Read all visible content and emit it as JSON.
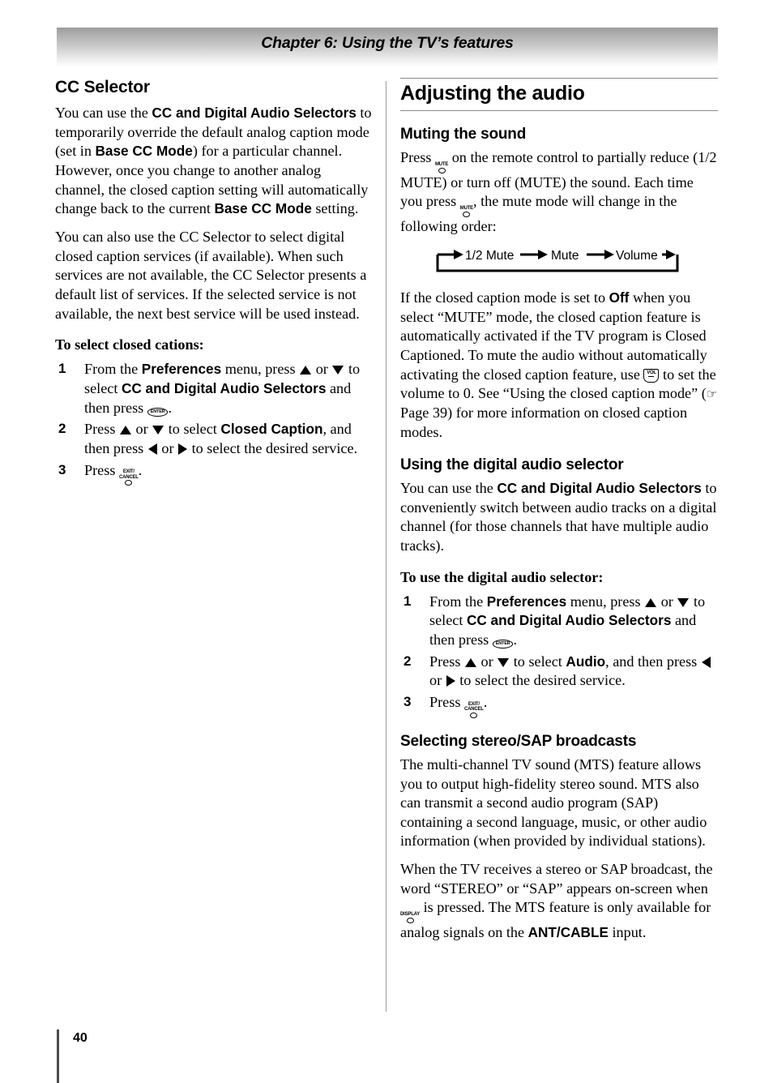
{
  "header": {
    "chapter_title": "Chapter 6: Using the TV’s features"
  },
  "footer": {
    "page_number": "40"
  },
  "left_column": {
    "section_heading": "CC Selector",
    "paragraph_1": {
      "part_1": "You can use the ",
      "bold_1": "CC and Digital Audio Selectors",
      "part_2": " to temporarily override the default analog caption mode (set in ",
      "bold_2": "Base CC Mode",
      "part_3": ") for a particular channel. However, once you change to another analog channel, the closed caption setting will automatically change back to the current ",
      "bold_3": "Base CC Mode",
      "part_4": " setting."
    },
    "paragraph_2": "You can also use the CC Selector to select digital closed caption services (if available). When such services are not available, the CC Selector presents a default list of services. If the selected service is not available, the next best service will be used instead.",
    "procedure_heading": "To select closed cations:",
    "steps": [
      {
        "number": "1",
        "part_1": "From the ",
        "bold_1": "Preferences",
        "part_2": " menu, press ",
        "arrow_up": "up-arrow",
        "part_3": " or ",
        "arrow_down": "down-arrow",
        "part_4": " to select ",
        "bold_2": "CC and Digital Audio Selectors",
        "part_5": " and then press ",
        "button": "ENTER",
        "part_6": "."
      },
      {
        "number": "2",
        "part_1": "Press ",
        "arrow_up": "up-arrow",
        "part_2": " or ",
        "arrow_down": "down-arrow",
        "part_3": " to select ",
        "bold_1": "Closed Caption",
        "part_4": ", and then press ",
        "arrow_left": "left-arrow",
        "part_5": " or ",
        "arrow_right": "right-arrow",
        "part_6": " to select the desired service."
      },
      {
        "number": "3",
        "part_1": "Press ",
        "button_line_1": "EXIT/",
        "button_line_2": "CANCEL",
        "part_2": "."
      }
    ]
  },
  "right_column": {
    "major_heading": "Adjusting the audio",
    "muting": {
      "heading": "Muting the sound",
      "paragraph": {
        "part_1": "Press ",
        "button_1": "MUTE",
        "part_2": " on the remote control to partially reduce (1/2 MUTE) or turn off (MUTE) the sound. Each time you press ",
        "button_2": "MUTE",
        "part_3": ", the mute mode will change in the following order:"
      },
      "cycle_diagram": {
        "items": [
          "1/2 Mute",
          "Mute",
          "Volume"
        ],
        "loop_back": true
      },
      "paragraph_2": {
        "part_1": "If the closed caption mode is set to ",
        "bold_1": "Off",
        "part_2": " when you select “MUTE” mode, the closed caption feature is automatically activated if the TV program is Closed Captioned. To mute the audio without automatically activating the closed caption feature, use ",
        "button_1": "VOL",
        "part_3": " to set the volume to 0. See “Using the closed caption mode” (",
        "hand_icon": "pointing-hand",
        "part_4": " Page 39) for more information on closed caption modes."
      }
    },
    "digital_selector": {
      "heading": "Using the digital audio selector",
      "paragraph": {
        "part_1": "You can use the ",
        "bold_1": "CC and Digital Audio Selectors",
        "part_2": " to conveniently switch between audio tracks on a digital channel (for those channels that have multiple audio tracks)."
      },
      "procedure_heading": "To use the digital audio selector:",
      "steps": [
        {
          "number": "1",
          "part_1": "From the ",
          "bold_1": "Preferences",
          "part_2": " menu, press ",
          "arrow_up": "up-arrow",
          "part_3": " or ",
          "arrow_down": "down-arrow",
          "part_4": " to select ",
          "bold_2": "CC and Digital Audio Selectors",
          "part_5": " and then press ",
          "button": "ENTER",
          "part_6": "."
        },
        {
          "number": "2",
          "part_1": "Press ",
          "arrow_up": "up-arrow",
          "part_2": " or ",
          "arrow_down": "down-arrow",
          "part_3": " to select ",
          "bold_1": "Audio",
          "part_4": ", and then press ",
          "arrow_left": "left-arrow",
          "part_5": " or ",
          "arrow_right": "right-arrow",
          "part_6": " to select the desired service."
        },
        {
          "number": "3",
          "part_1": "Press ",
          "button_line_1": "EXIT/",
          "button_line_2": "CANCEL",
          "part_2": "."
        }
      ]
    },
    "stereo_sap": {
      "heading": "Selecting stereo/SAP broadcasts",
      "paragraph_1": "The multi-channel TV sound (MTS) feature allows you to output high-fidelity stereo sound. MTS also can transmit a second audio program (SAP) containing a second language, music, or other audio information (when provided by individual stations).",
      "paragraph_2": {
        "part_1": "When the TV receives a stereo or SAP broadcast, the word “STEREO” or “SAP” appears on-screen when ",
        "button_1": "DISPLAY",
        "part_2": " is pressed. The MTS feature is only available for analog signals on the ",
        "bold_1": "ANT/CABLE",
        "part_3": " input."
      }
    }
  },
  "colors": {
    "text": "#000000",
    "rule": "#8a8a8a",
    "header_gradient_top": "#9d9d9d",
    "header_gradient_bottom": "#ffffff"
  }
}
